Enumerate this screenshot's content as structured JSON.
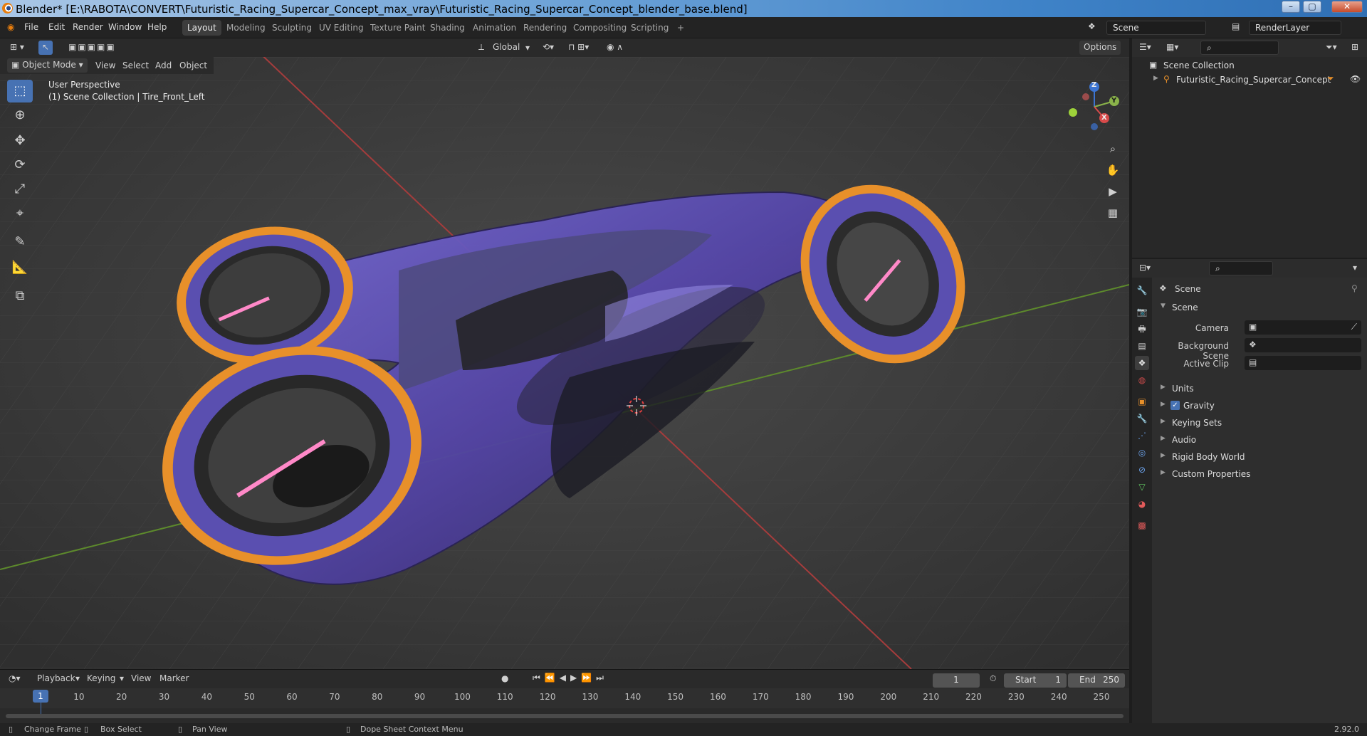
{
  "window": {
    "title": "Blender* [E:\\RABOTA\\CONVERT\\Futuristic_Racing_Supercar_Concept_max_vray\\Futuristic_Racing_Supercar_Concept_blender_base.blend]",
    "minimize": "–",
    "maximize": "▢",
    "close": "✕"
  },
  "menu": {
    "file": "File",
    "edit": "Edit",
    "render": "Render",
    "window": "Window",
    "help": "Help"
  },
  "workspaces": [
    "Layout",
    "Modeling",
    "Sculpting",
    "UV Editing",
    "Texture Paint",
    "Shading",
    "Animation",
    "Rendering",
    "Compositing",
    "Scripting"
  ],
  "workspace_add": "+",
  "scene_field": "Scene",
  "renderlayer_field": "RenderLayer",
  "viewport_header": {
    "mode": "Object Mode",
    "view": "View",
    "select": "Select",
    "add": "Add",
    "object": "Object",
    "orientation": "Global",
    "options": "Options"
  },
  "viewport": {
    "perspective": "User Perspective",
    "collection": "(1) Scene Collection | Tire_Front_Left"
  },
  "gizmo": {
    "z": "Z",
    "y": "Y",
    "x": "X"
  },
  "timeline": {
    "playback": "Playback",
    "keying": "Keying",
    "view": "View",
    "marker": "Marker",
    "current_frame": "1",
    "start_label": "Start",
    "start": "1",
    "end_label": "End",
    "end": "250",
    "cursor_frame": "1",
    "ticks": [
      "10",
      "20",
      "30",
      "40",
      "50",
      "60",
      "70",
      "80",
      "90",
      "100",
      "110",
      "120",
      "130",
      "140",
      "150",
      "160",
      "170",
      "180",
      "190",
      "200",
      "210",
      "220",
      "230",
      "240",
      "250"
    ]
  },
  "statusbar": {
    "change_frame": "Change Frame",
    "box_select": "Box Select",
    "pan_view": "Pan View",
    "context_menu": "Dope Sheet Context Menu",
    "version": "2.92.0"
  },
  "outliner": {
    "scene_collection": "Scene Collection",
    "object": "Futuristic_Racing_Supercar_Concept"
  },
  "properties": {
    "context": "Scene",
    "panel": "Scene",
    "camera_label": "Camera",
    "background_label": "Background Scene",
    "clip_label": "Active Clip",
    "sections": [
      "Units",
      "Gravity",
      "Keying Sets",
      "Audio",
      "Rigid Body World",
      "Custom Properties"
    ],
    "gravity_checked": true
  },
  "colors": {
    "accent": "#4772b3",
    "x_axis": "#d84a4a",
    "y_axis": "#8ab34a",
    "body": "#5a4fb0",
    "wheel_glow": "#e8902a"
  }
}
